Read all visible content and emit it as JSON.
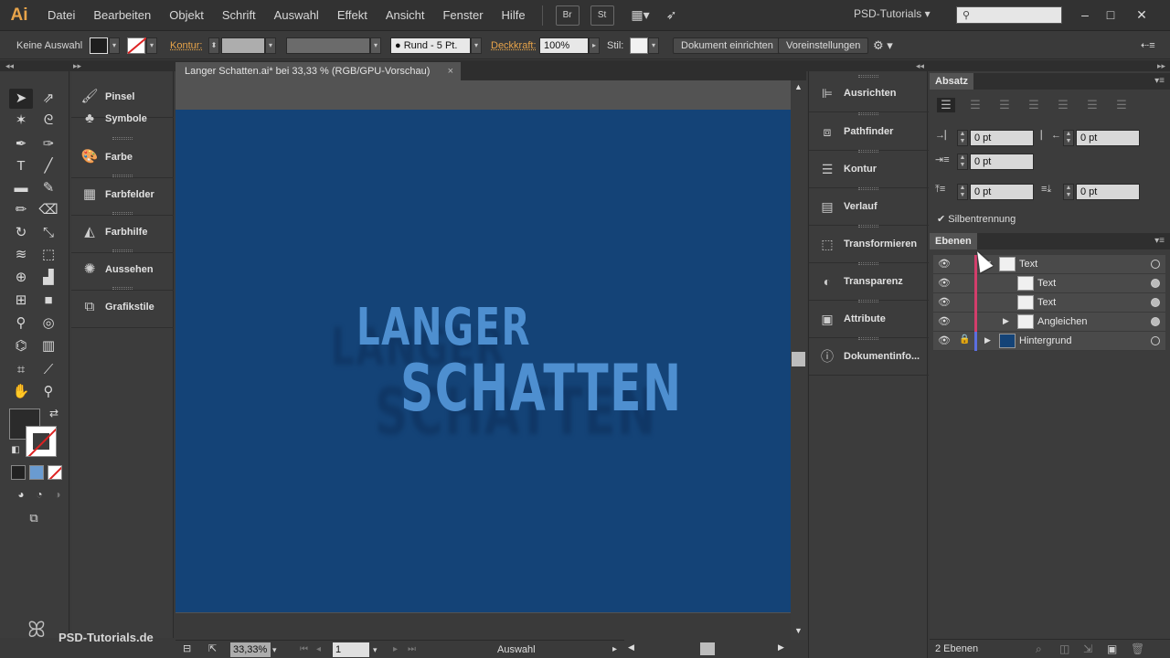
{
  "app": {
    "logo": "Ai"
  },
  "menu": {
    "items": [
      "Datei",
      "Bearbeiten",
      "Objekt",
      "Schrift",
      "Auswahl",
      "Effekt",
      "Ansicht",
      "Fenster",
      "Hilfe"
    ],
    "icon_buttons": [
      "Br",
      "St"
    ],
    "workspace": "PSD-Tutorials",
    "window_controls": [
      "–",
      "□",
      "✕"
    ]
  },
  "control_bar": {
    "selection": "Keine Auswahl",
    "kontur_label": "Kontur:",
    "brush": "Rund - 5 Pt.",
    "deckkraft_label": "Deckkraft:",
    "deckkraft_value": "100%",
    "stil_label": "Stil:",
    "doc_setup_button": "Dokument einrichten",
    "preferences_button": "Voreinstellungen"
  },
  "document": {
    "tab_title": "Langer Schatten.ai* bei 33,33 % (RGB/GPU-Vorschau)",
    "tab_close": "×",
    "artwork_line1": "LANGER",
    "artwork_line2": "SCHATTEN",
    "artboard_color": "#144377",
    "text_color": "#4e8fd0"
  },
  "status_bar": {
    "zoom": "33,33%",
    "page": "1",
    "tool_status": "Auswahl"
  },
  "left_panels": [
    {
      "label": "Pinsel",
      "icon": "brush-icon"
    },
    {
      "label": "Symbole",
      "icon": "symbols-icon"
    },
    {
      "label": "Farbe",
      "icon": "palette-icon"
    },
    {
      "label": "Farbfelder",
      "icon": "swatches-icon"
    },
    {
      "label": "Farbhilfe",
      "icon": "color-guide-icon"
    },
    {
      "label": "Aussehen",
      "icon": "appearance-icon"
    },
    {
      "label": "Grafikstile",
      "icon": "graphic-styles-icon"
    }
  ],
  "mid_panels": [
    {
      "label": "Ausrichten",
      "icon": "align-icon"
    },
    {
      "label": "Pathfinder",
      "icon": "pathfinder-icon"
    },
    {
      "label": "Kontur",
      "icon": "stroke-icon"
    },
    {
      "label": "Verlauf",
      "icon": "gradient-icon"
    },
    {
      "label": "Transformieren",
      "icon": "transform-icon"
    },
    {
      "label": "Transparenz",
      "icon": "transparency-icon"
    },
    {
      "label": "Attribute",
      "icon": "attributes-icon"
    },
    {
      "label": "Dokumentinfo...",
      "icon": "document-info-icon"
    }
  ],
  "absatz": {
    "title": "Absatz",
    "left_indent": "0 pt",
    "right_indent": "0 pt",
    "first_line_indent": "0 pt",
    "space_before": "0 pt",
    "space_after": "0 pt",
    "hyphenation_label": "Silbentrennung"
  },
  "ebenen": {
    "title": "Ebenen",
    "layers": [
      {
        "name": "Text",
        "depth": 0,
        "expanded": true
      },
      {
        "name": "Text",
        "depth": 1
      },
      {
        "name": "Text",
        "depth": 1
      },
      {
        "name": "Angleichen",
        "depth": 1,
        "collapsed": true
      },
      {
        "name": "Hintergrund",
        "depth": 0,
        "locked": true
      }
    ],
    "count_label": "2 Ebenen"
  },
  "watermark": {
    "text": "PSD-Tutorials.de"
  }
}
